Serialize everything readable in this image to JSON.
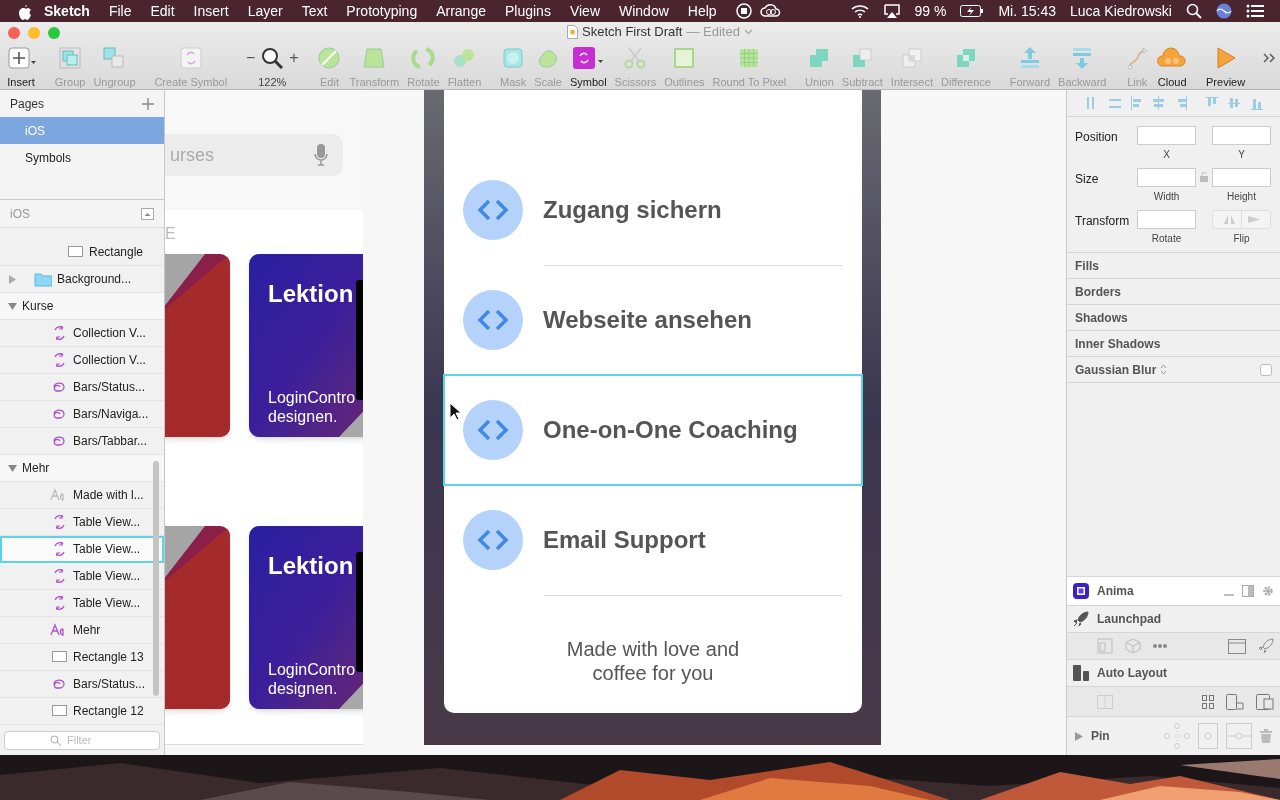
{
  "menubar": {
    "app": "Sketch",
    "menus": [
      "File",
      "Edit",
      "Insert",
      "Layer",
      "Text",
      "Prototyping",
      "Arrange",
      "Plugins",
      "View",
      "Window",
      "Help"
    ],
    "battery": "99 %",
    "clock": "Mi. 15:43",
    "user": "Luca Kiedrowski"
  },
  "window": {
    "title": "Sketch First Draft",
    "state": "— Edited"
  },
  "toolbar": [
    [
      {
        "label": "Insert",
        "kind": "insert"
      }
    ],
    [
      {
        "label": "Group",
        "kind": "group"
      },
      {
        "label": "Ungroup",
        "kind": "ungroup"
      }
    ],
    [
      {
        "label": "Create Symbol",
        "kind": "create-symbol"
      }
    ],
    [
      {
        "label": "122%",
        "kind": "zoom",
        "minus": "−",
        "plus": "+"
      }
    ],
    [
      {
        "label": "Edit",
        "kind": "edit"
      },
      {
        "label": "Transform",
        "kind": "transform"
      },
      {
        "label": "Rotate",
        "kind": "rotate"
      },
      {
        "label": "Flatten",
        "kind": "flatten"
      }
    ],
    [
      {
        "label": "Mask",
        "kind": "mask"
      },
      {
        "label": "Scale",
        "kind": "scale"
      },
      {
        "label": "Symbol",
        "kind": "symbol"
      },
      {
        "label": "Scissors",
        "kind": "scissors"
      },
      {
        "label": "Outlines",
        "kind": "outlines"
      },
      {
        "label": "Round To Pixel",
        "kind": "pixel"
      }
    ],
    [
      {
        "label": "Union",
        "kind": "union"
      },
      {
        "label": "Subtract",
        "kind": "subtract"
      },
      {
        "label": "Intersect",
        "kind": "intersect"
      },
      {
        "label": "Difference",
        "kind": "difference"
      }
    ],
    [
      {
        "label": "Forward",
        "kind": "forward"
      },
      {
        "label": "Backward",
        "kind": "backward"
      }
    ],
    [
      {
        "label": "Link",
        "kind": "link"
      },
      {
        "label": "Cloud",
        "kind": "cloud"
      }
    ],
    [
      {
        "label": "Preview",
        "kind": "preview"
      }
    ]
  ],
  "pages": {
    "title": "Pages",
    "items": [
      {
        "label": "iOS",
        "selected": true
      },
      {
        "label": "Symbols",
        "selected": false
      }
    ]
  },
  "layers": {
    "title": "iOS",
    "filter_placeholder": "Filter",
    "items": [
      {
        "children": [
          {
            "name": "Rectangle",
            "kind": "rect",
            "selected": false
          }
        ]
      },
      {
        "name": "Background...",
        "kind": "folder",
        "expanded": false,
        "selected": false
      },
      {
        "name": "Kurse",
        "kind": "artboard",
        "expanded": true,
        "selected": false,
        "children": [
          {
            "name": "Collection V...",
            "kind": "symbol",
            "selected": false
          },
          {
            "name": "Collection V...",
            "kind": "symbol",
            "selected": false
          },
          {
            "name": "Bars/Status...",
            "kind": "symbol-ref",
            "selected": false
          },
          {
            "name": "Bars/Naviga...",
            "kind": "symbol-ref",
            "selected": false
          },
          {
            "name": "Bars/Tabbar...",
            "kind": "symbol-ref",
            "selected": false
          }
        ]
      },
      {
        "name": "Mehr",
        "kind": "artboard",
        "expanded": true,
        "selected": false,
        "children": [
          {
            "name": "Made with l...",
            "kind": "text-muted",
            "selected": false
          },
          {
            "name": "Table View...",
            "kind": "symbol",
            "selected": false
          },
          {
            "name": "Table View...",
            "kind": "symbol",
            "selected": true
          },
          {
            "name": "Table View...",
            "kind": "symbol",
            "selected": false
          },
          {
            "name": "Table View...",
            "kind": "symbol",
            "selected": false
          },
          {
            "name": "Mehr",
            "kind": "text",
            "selected": false
          },
          {
            "name": "Rectangle 13",
            "kind": "rect",
            "selected": false
          },
          {
            "name": "Bars/Status...",
            "kind": "symbol-ref",
            "selected": false
          },
          {
            "name": "Rectangle 12",
            "kind": "rect",
            "selected": false
          }
        ]
      }
    ]
  },
  "kurse_artboard": {
    "search_text": "urses",
    "section_label": "E",
    "card_rows": [
      {
        "title": "Lektion",
        "body": [
          "LoginContro",
          "designen."
        ]
      },
      {
        "title": "Lektion",
        "body": [
          "LoginContro",
          "designen."
        ]
      }
    ]
  },
  "mehr_artboard": {
    "rows": [
      {
        "title": "Zugang sichern",
        "selected": false,
        "divider": true
      },
      {
        "title": "Webseite ansehen",
        "selected": false,
        "divider": false
      },
      {
        "title": "One-on-One Coaching",
        "selected": true,
        "divider": false
      },
      {
        "title": "Email Support",
        "selected": false,
        "divider": true
      }
    ],
    "footer": "Made with love and coffee for you"
  },
  "inspector": {
    "rows": [
      {
        "label": "Position",
        "fields": [
          {
            "kind": "input",
            "caption": "X"
          },
          {
            "kind": "input",
            "caption": "Y"
          }
        ],
        "lock": false
      },
      {
        "label": "Size",
        "fields": [
          {
            "kind": "input",
            "caption": "Width"
          },
          {
            "kind": "input",
            "caption": "Height"
          }
        ],
        "lock": true
      },
      {
        "label": "Transform",
        "fields": [
          {
            "kind": "input",
            "caption": "Rotate"
          },
          {
            "kind": "flip",
            "caption": "Flip"
          }
        ],
        "lock": false
      }
    ],
    "sections": [
      {
        "label": "Fills"
      },
      {
        "label": "Borders"
      },
      {
        "label": "Shadows"
      },
      {
        "label": "Inner Shadows"
      },
      {
        "label": "Gaussian Blur",
        "kind": "blur",
        "checked": false
      }
    ],
    "plugins": [
      {
        "name": "Anima",
        "kind": "anima"
      },
      {
        "name": "Launchpad",
        "kind": "launchpad"
      },
      {
        "name": "Auto Layout",
        "kind": "autolayout"
      },
      {
        "name": "Pin",
        "kind": "pin"
      }
    ]
  }
}
